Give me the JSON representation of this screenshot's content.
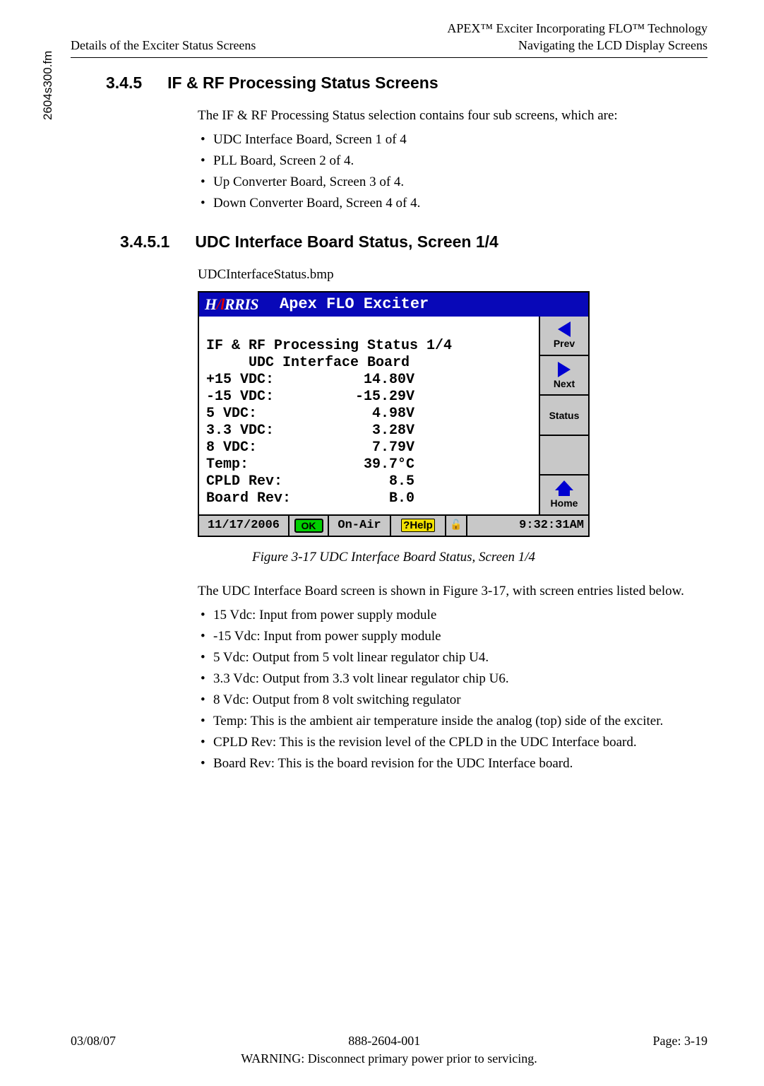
{
  "header": {
    "left": "Details of the Exciter Status Screens",
    "right_top": "APEX™ Exciter Incorporating FLO™ Technology",
    "right_bottom": "Navigating the LCD Display Screens"
  },
  "side_label": "2604s300.fm",
  "sec_345": {
    "num": "3.4.5",
    "title": "IF & RF Processing Status Screens"
  },
  "intro_para": "The IF & RF Processing Status selection contains four sub screens, which are:",
  "sub_list": [
    "UDC Interface Board, Screen 1 of 4",
    "PLL Board, Screen 2 of 4.",
    "Up Converter Board, Screen 3 of 4.",
    "Down Converter Board, Screen 4 of 4."
  ],
  "sec_3451": {
    "num": "3.4.5.1",
    "title": "UDC Interface Board Status, Screen 1/4"
  },
  "bmp_label": "UDCInterfaceStatus.bmp",
  "lcd": {
    "logo_pre": "H",
    "logo_post": "RRIS",
    "title": "Apex FLO Exciter",
    "line1": "IF & RF Processing Status 1/4",
    "line2": "     UDC Interface Board",
    "rows": [
      {
        "lbl": "+15 VDC:",
        "val": "14.80V"
      },
      {
        "lbl": "-15 VDC:",
        "val": "-15.29V"
      },
      {
        "lbl": "5 VDC:",
        "val": "4.98V"
      },
      {
        "lbl": "3.3 VDC:",
        "val": "3.28V"
      },
      {
        "lbl": "8 VDC:",
        "val": "7.79V"
      },
      {
        "lbl": "Temp:",
        "val": "39.7°C"
      },
      {
        "lbl": "CPLD Rev:",
        "val": "8.5"
      },
      {
        "lbl": "Board Rev:",
        "val": "B.0"
      }
    ],
    "btns": {
      "prev": "Prev",
      "next": "Next",
      "status": "Status",
      "home": "Home"
    },
    "status": {
      "date": "11/17/2006",
      "ok": "OK",
      "onair": "On-Air",
      "help_q": "?",
      "help": "Help",
      "lock": "🔓",
      "time": "9:32:31AM"
    }
  },
  "fig_caption": "Figure 3-17  UDC Interface Board Status, Screen 1/4",
  "post_para": "The UDC Interface Board screen is shown in Figure 3-17, with screen entries listed below.",
  "field_list": [
    "15 Vdc: Input from power supply module",
    "-15 Vdc: Input from power supply module",
    "5 Vdc: Output from 5 volt linear regulator chip U4.",
    "3.3 Vdc: Output from 3.3 volt linear regulator chip U6.",
    "8 Vdc: Output from 8 volt switching regulator",
    "Temp: This is the ambient air temperature inside the analog (top) side of the exciter.",
    "CPLD Rev: This is the revision level of the CPLD in the UDC Interface board.",
    "Board Rev: This is the board revision for the UDC Interface board."
  ],
  "footer": {
    "date": "03/08/07",
    "doc": "888-2604-001",
    "page": "Page: 3-19",
    "warn": "WARNING: Disconnect primary power prior to servicing."
  }
}
